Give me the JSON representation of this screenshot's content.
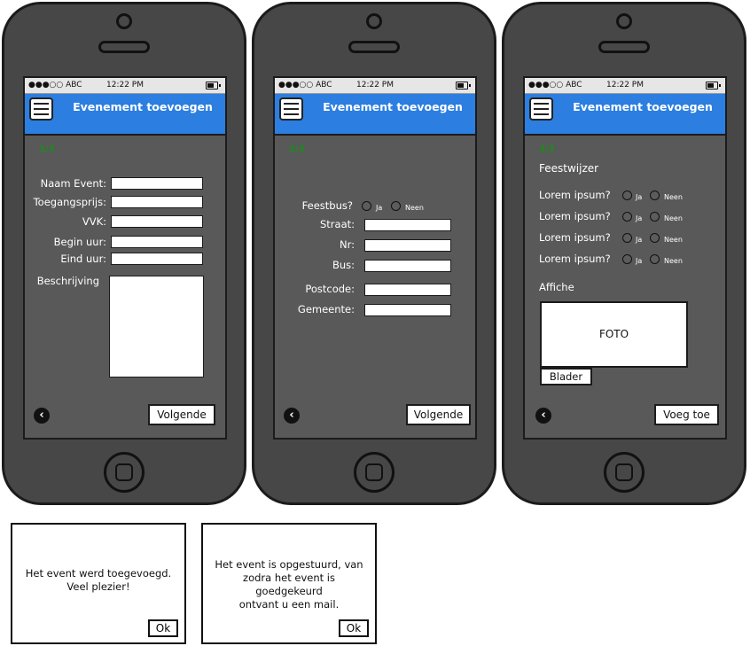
{
  "status_bar": {
    "signal": "●●●○○ ABC",
    "time": "12:22 PM"
  },
  "screens": [
    {
      "title": "Evenement toevoegen",
      "step": "1/3",
      "fields": [
        "Naam Event:",
        "Toegangsprijs:",
        "VVK:",
        "Begin uur:",
        "Eind uur:"
      ],
      "description_label": "Beschrijving",
      "next_label": "Volgende"
    },
    {
      "title": "Evenement toevoegen",
      "step": "2/3",
      "question": "Feestbus?",
      "yes": "Ja",
      "no": "Neen",
      "fields": [
        "Straat:",
        "Nr:",
        "Bus:",
        "Postcode:",
        "Gemeente:"
      ],
      "next_label": "Volgende"
    },
    {
      "title": "Evenement toevoegen",
      "step": "3/3",
      "section_title": "Feestwijzer",
      "questions": [
        "Lorem ipsum?",
        "Lorem ipsum?",
        "Lorem ipsum?",
        "Lorem ipsum?"
      ],
      "yes": "Ja",
      "no": "Neen",
      "poster_label": "Affiche",
      "photo_label": "FOTO",
      "browse_label": "Blader",
      "submit_label": "Voeg toe"
    }
  ],
  "dialogs": [
    {
      "message_line1": "Het event werd toegevoegd.",
      "message_line2": "Veel plezier!",
      "ok": "Ok"
    },
    {
      "message_line1": "Het event is opgestuurd, van",
      "message_line2": "zodra het event is goedgekeurd",
      "message_line3": "ontvant u een mail.",
      "ok": "Ok"
    }
  ],
  "colors": {
    "appbar": "#2c7ee0",
    "screen": "#595959",
    "step": "#1a8d1a"
  }
}
